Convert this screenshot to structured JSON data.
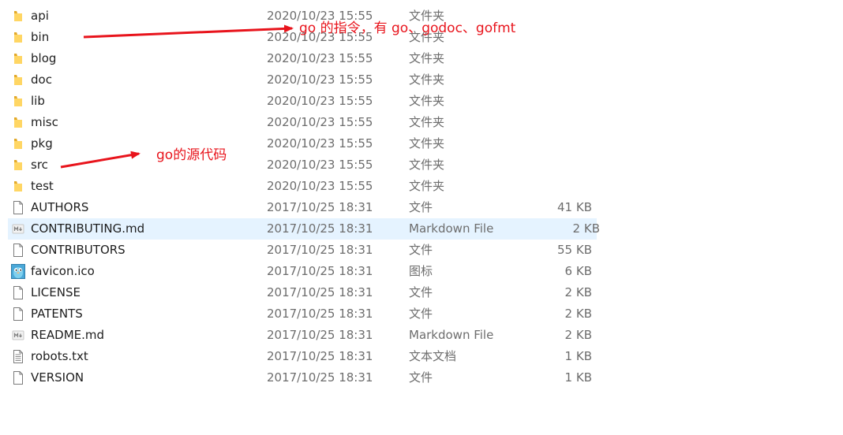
{
  "files": [
    {
      "name": "api",
      "date": "2020/10/23 15:55",
      "type": "文件夹",
      "size": "",
      "icon": "folder-icon"
    },
    {
      "name": "bin",
      "date": "2020/10/23 15:55",
      "type": "文件夹",
      "size": "",
      "icon": "folder-icon"
    },
    {
      "name": "blog",
      "date": "2020/10/23 15:55",
      "type": "文件夹",
      "size": "",
      "icon": "folder-icon"
    },
    {
      "name": "doc",
      "date": "2020/10/23 15:55",
      "type": "文件夹",
      "size": "",
      "icon": "folder-icon"
    },
    {
      "name": "lib",
      "date": "2020/10/23 15:55",
      "type": "文件夹",
      "size": "",
      "icon": "folder-icon"
    },
    {
      "name": "misc",
      "date": "2020/10/23 15:55",
      "type": "文件夹",
      "size": "",
      "icon": "folder-icon"
    },
    {
      "name": "pkg",
      "date": "2020/10/23 15:55",
      "type": "文件夹",
      "size": "",
      "icon": "folder-icon"
    },
    {
      "name": "src",
      "date": "2020/10/23 15:55",
      "type": "文件夹",
      "size": "",
      "icon": "folder-icon"
    },
    {
      "name": "test",
      "date": "2020/10/23 15:55",
      "type": "文件夹",
      "size": "",
      "icon": "folder-icon"
    },
    {
      "name": "AUTHORS",
      "date": "2017/10/25 18:31",
      "type": "文件",
      "size": "41 KB",
      "icon": "file-icon"
    },
    {
      "name": "CONTRIBUTING.md",
      "date": "2017/10/25 18:31",
      "type": "Markdown File",
      "size": "2 KB",
      "icon": "markdown-file-icon",
      "selected": true
    },
    {
      "name": "CONTRIBUTORS",
      "date": "2017/10/25 18:31",
      "type": "文件",
      "size": "55 KB",
      "icon": "file-icon"
    },
    {
      "name": "favicon.ico",
      "date": "2017/10/25 18:31",
      "type": "图标",
      "size": "6 KB",
      "icon": "gopher-image-icon"
    },
    {
      "name": "LICENSE",
      "date": "2017/10/25 18:31",
      "type": "文件",
      "size": "2 KB",
      "icon": "file-icon"
    },
    {
      "name": "PATENTS",
      "date": "2017/10/25 18:31",
      "type": "文件",
      "size": "2 KB",
      "icon": "file-icon"
    },
    {
      "name": "README.md",
      "date": "2017/10/25 18:31",
      "type": "Markdown File",
      "size": "2 KB",
      "icon": "markdown-file-icon"
    },
    {
      "name": "robots.txt",
      "date": "2017/10/25 18:31",
      "type": "文本文档",
      "size": "1 KB",
      "icon": "text-file-icon"
    },
    {
      "name": "VERSION",
      "date": "2017/10/25 18:31",
      "type": "文件",
      "size": "1 KB",
      "icon": "file-icon"
    }
  ],
  "annotations": {
    "bin_note": "go 的指令，有 go、godoc、gofmt",
    "src_note": "go的源代码"
  },
  "colors": {
    "annotation": "#e8141c",
    "selection": "#e5f3ff",
    "folder": "#f5c242",
    "secondary_text": "#6d6d6d"
  }
}
